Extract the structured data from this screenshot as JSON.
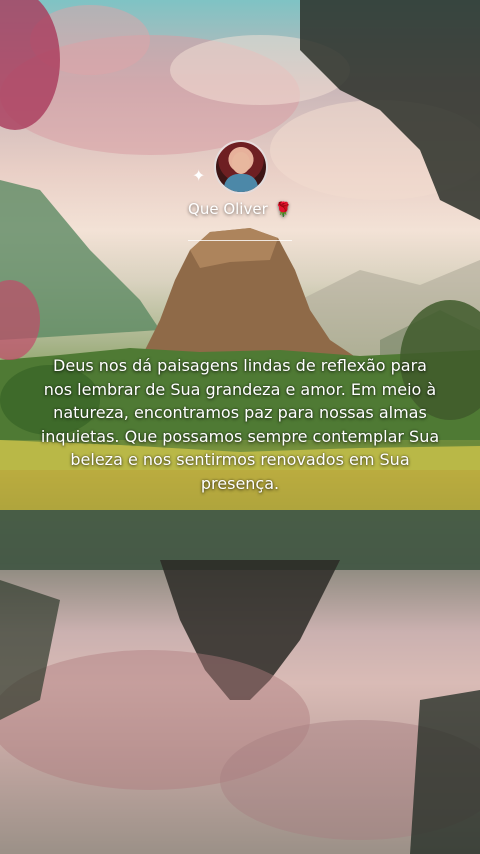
{
  "profile": {
    "name": "Que Oliver",
    "rose": "🌹",
    "sparkle": "✦"
  },
  "message": {
    "text": "Deus nos dá paisagens lindas de reflexão para nos lembrar de Sua grandeza e amor. Em meio à natureza, encontramos paz para nossas almas inquietas. Que possamos sempre contemplar Sua beleza e nos sentirmos renovados em Sua presença."
  },
  "colors": {
    "sky": "#7fc3c4",
    "cloud_pink": "#e6b8b8",
    "grass": "#9fae4c",
    "water": "#c7b1b3"
  }
}
